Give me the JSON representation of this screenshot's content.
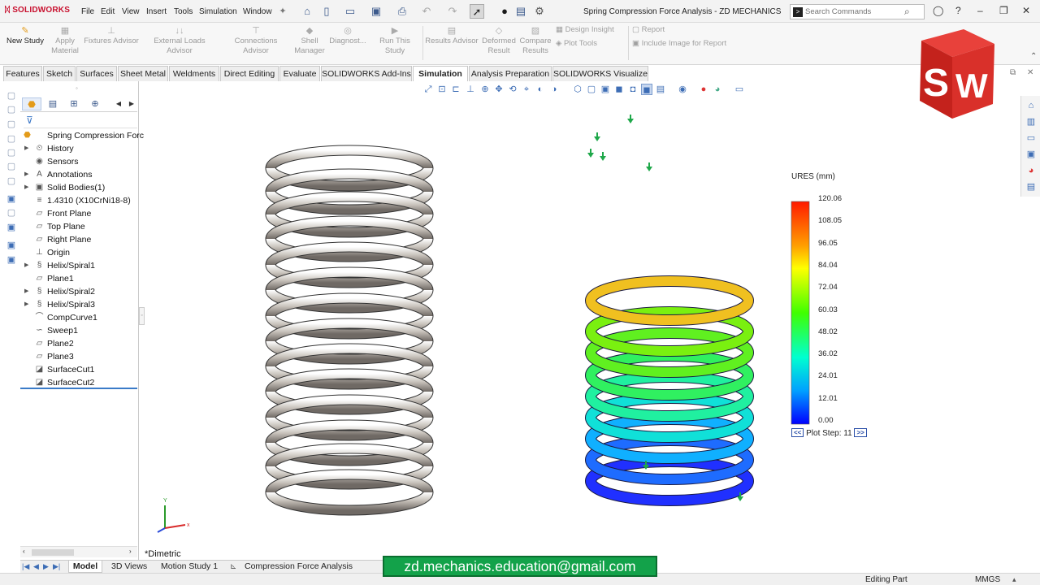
{
  "app": {
    "logo_text": "SOLIDWORKS",
    "doc_title": "Spring Compression Force Analysis - ZD MECHANICS",
    "menus": [
      "File",
      "Edit",
      "View",
      "Insert",
      "Tools",
      "Simulation",
      "Window"
    ],
    "search_placeholder": "Search Commands"
  },
  "commands": {
    "new_study": "New Study",
    "apply_material": [
      "Apply",
      "Material"
    ],
    "fixtures_advisor": "Fixtures Advisor",
    "external_loads_advisor": "External Loads Advisor",
    "connections_advisor": "Connections Advisor",
    "shell_manager": [
      "Shell",
      "Manager"
    ],
    "diagnostics": "Diagnost...",
    "run_this_study": "Run This Study",
    "results_advisor": "Results Advisor",
    "deformed_result": [
      "Deformed",
      "Result"
    ],
    "compare_results": [
      "Compare",
      "Results"
    ],
    "design_insight": "Design Insight",
    "plot_tools": "Plot Tools",
    "report": "Report",
    "include_image": "Include Image for Report"
  },
  "tabs": [
    "Features",
    "Sketch",
    "Surfaces",
    "Sheet Metal",
    "Weldments",
    "Direct Editing",
    "Evaluate",
    "SOLIDWORKS Add-Ins",
    "Simulation",
    "Analysis Preparation",
    "SOLIDWORKS Visualize"
  ],
  "active_tab": "Simulation",
  "tree": {
    "root": "Spring Compression Forc",
    "items": [
      {
        "label": "History",
        "icon": "history-icon",
        "expand": true
      },
      {
        "label": "Sensors",
        "icon": "sensors-icon",
        "expand": false
      },
      {
        "label": "Annotations",
        "icon": "annotations-icon",
        "expand": true
      },
      {
        "label": "Solid Bodies(1)",
        "icon": "solid-bodies-icon",
        "expand": true
      },
      {
        "label": "1.4310 (X10CrNi18-8)",
        "icon": "material-icon",
        "expand": false
      },
      {
        "label": "Front Plane",
        "icon": "plane-icon",
        "expand": false
      },
      {
        "label": "Top Plane",
        "icon": "plane-icon",
        "expand": false
      },
      {
        "label": "Right Plane",
        "icon": "plane-icon",
        "expand": false
      },
      {
        "label": "Origin",
        "icon": "origin-icon",
        "expand": false
      },
      {
        "label": "Helix/Spiral1",
        "icon": "helix-icon",
        "expand": true
      },
      {
        "label": "Plane1",
        "icon": "plane-icon",
        "expand": false
      },
      {
        "label": "Helix/Spiral2",
        "icon": "helix-icon",
        "expand": true
      },
      {
        "label": "Helix/Spiral3",
        "icon": "helix-icon",
        "expand": true
      },
      {
        "label": "CompCurve1",
        "icon": "curve-icon",
        "expand": false
      },
      {
        "label": "Sweep1",
        "icon": "sweep-icon",
        "expand": false
      },
      {
        "label": "Plane2",
        "icon": "plane-icon",
        "expand": false
      },
      {
        "label": "Plane3",
        "icon": "plane-icon",
        "expand": false
      },
      {
        "label": "SurfaceCut1",
        "icon": "surface-cut-icon",
        "expand": false
      },
      {
        "label": "SurfaceCut2",
        "icon": "surface-cut-icon",
        "expand": false
      }
    ]
  },
  "legend": {
    "title": "URES (mm)",
    "ticks": [
      "120.06",
      "108.05",
      "96.05",
      "84.04",
      "72.04",
      "60.03",
      "48.02",
      "36.02",
      "24.01",
      "12.01",
      "0.00"
    ],
    "plot_step_prev": "<<",
    "plot_step_label": "Plot Step: 11",
    "plot_step_next": ">>"
  },
  "view_name": "*Dimetric",
  "bottom_tabs": [
    "Model",
    "3D Views",
    "Motion Study 1",
    "Compression Force Analysis"
  ],
  "active_bottom_tab": "Model",
  "status": {
    "mode": "Editing Part",
    "units": "MMGS"
  },
  "email_banner": "zd.mechanics.education@gmail.com",
  "cube_text": "SW",
  "triad": {
    "x": "x",
    "y": "Y"
  }
}
